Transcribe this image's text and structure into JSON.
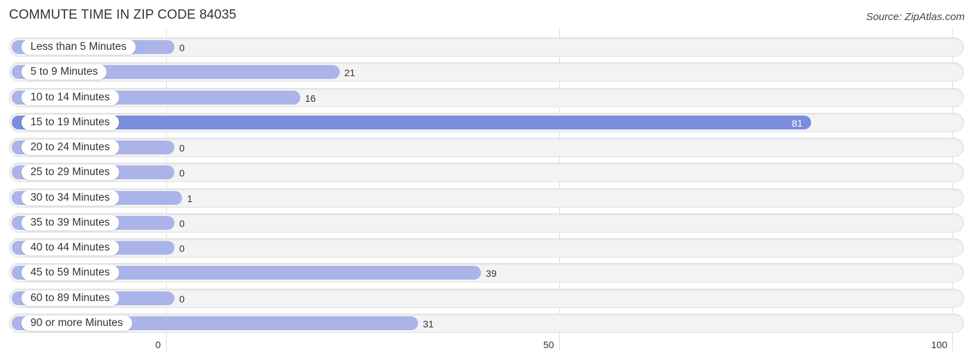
{
  "title": "COMMUTE TIME IN ZIP CODE 84035",
  "source": "Source: ZipAtlas.com",
  "colors": {
    "bar_normal": "#aab4e8",
    "bar_highlight": "#7b8cdc",
    "track": "#f3f3f3"
  },
  "chart_data": {
    "type": "bar",
    "orientation": "horizontal",
    "title": "COMMUTE TIME IN ZIP CODE 84035",
    "xlabel": "",
    "ylabel": "",
    "xlim": [
      0,
      100
    ],
    "x_ticks": [
      "0",
      "50",
      "100"
    ],
    "grid": true,
    "categories": [
      "Less than 5 Minutes",
      "5 to 9 Minutes",
      "10 to 14 Minutes",
      "15 to 19 Minutes",
      "20 to 24 Minutes",
      "25 to 29 Minutes",
      "30 to 34 Minutes",
      "35 to 39 Minutes",
      "40 to 44 Minutes",
      "45 to 59 Minutes",
      "60 to 89 Minutes",
      "90 or more Minutes"
    ],
    "values": [
      0,
      21,
      16,
      81,
      0,
      0,
      1,
      0,
      0,
      39,
      0,
      31
    ],
    "highlight_index": 3
  }
}
